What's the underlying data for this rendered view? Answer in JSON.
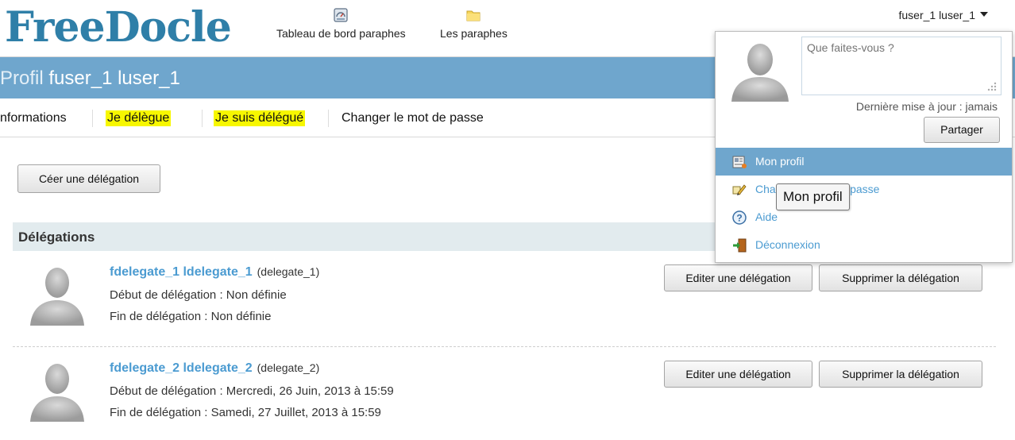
{
  "header": {
    "logo": "FreeDocle",
    "nav": [
      {
        "label": "Tableau de bord paraphes",
        "icon": "dashboard-icon"
      },
      {
        "label": "Les paraphes",
        "icon": "folder-icon"
      }
    ],
    "user_menu_label": "fuser_1 luser_1"
  },
  "title": {
    "prefix": "Profil",
    "name": "fuser_1 luser_1"
  },
  "tabs": [
    {
      "label": "nformations",
      "highlighted": false
    },
    {
      "label": "Je délègue",
      "highlighted": true
    },
    {
      "label": "Je suis délégué",
      "highlighted": true
    },
    {
      "label": "Changer le mot de passe",
      "highlighted": false
    }
  ],
  "create_button": "Céer une délégation",
  "section_title": "Délégations",
  "delegations": [
    {
      "name": "fdelegate_1 ldelegate_1",
      "login": "(delegate_1)",
      "start": "Début de délégation : Non définie",
      "end": "Fin de délégation : Non définie",
      "edit_label": "Editer une délégation",
      "delete_label": "Supprimer la délégation"
    },
    {
      "name": "fdelegate_2 ldelegate_2",
      "login": "(delegate_2)",
      "start": "Début de délégation : Mercredi, 26 Juin, 2013 à 15:59",
      "end": "Fin de délégation : Samedi, 27 Juillet, 2013 à 15:59",
      "edit_label": "Editer une délégation",
      "delete_label": "Supprimer la délégation"
    }
  ],
  "dropdown": {
    "status_placeholder": "Que faites-vous ?",
    "last_update": "Dernière mise à jour : jamais",
    "share_label": "Partager",
    "menu": [
      {
        "label": "Mon profil",
        "icon": "profile-card-icon",
        "active": true
      },
      {
        "label": "Changer le mot de passe",
        "icon": "pencil-icon",
        "active": false
      },
      {
        "label": "Aide",
        "icon": "help-icon",
        "active": false
      },
      {
        "label": "Déconnexion",
        "icon": "logout-icon",
        "active": false
      }
    ],
    "tooltip": "Mon profil"
  },
  "colors": {
    "brand": "#2f7fa8",
    "titlebar": "#6fa6cd",
    "link": "#4b9bd1",
    "highlight": "#f7f700",
    "section_bg": "#e2ebee"
  }
}
